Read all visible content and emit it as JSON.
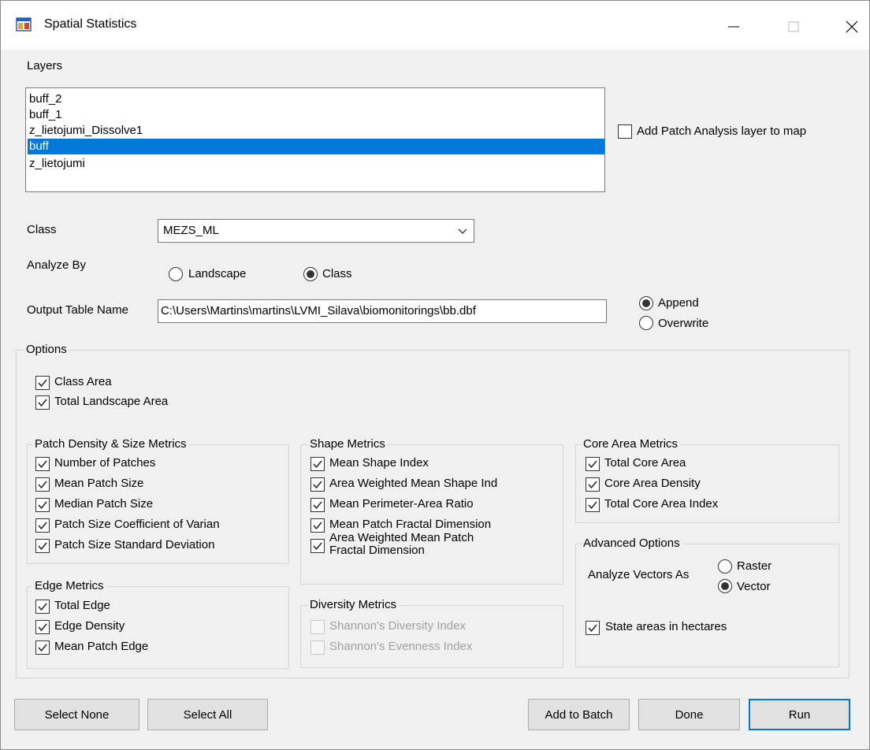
{
  "window": {
    "title": "Spatial Statistics",
    "icon": "app-window-icon",
    "controls": [
      "minimize-icon",
      "maximize-icon",
      "close-icon"
    ]
  },
  "layers": {
    "label": "Layers",
    "items": [
      "buff_2",
      "buff_1",
      "z_lietojumi_Dissolve1",
      "buff",
      "z_lietojumi"
    ],
    "selected": "buff"
  },
  "add_patch_layer": {
    "label": "Add Patch Analysis layer to map",
    "checked": false
  },
  "class": {
    "label": "Class",
    "value": "MEZS_ML"
  },
  "analyze_by": {
    "label": "Analyze By",
    "options": [
      "Landscape",
      "Class"
    ],
    "selected": "Class"
  },
  "output": {
    "label": "Output Table Name",
    "value": "C:\\Users\\Martins\\martins\\LVMI_Silava\\biomonitorings\\bb.dbf",
    "modes": [
      "Append",
      "Overwrite"
    ],
    "selected_mode": "Append"
  },
  "options": {
    "label": "Options",
    "class_area": {
      "label": "Class Area",
      "checked": true
    },
    "total_landscape_area": {
      "label": "Total Landscape Area",
      "checked": true
    }
  },
  "patch_density": {
    "title": "Patch Density & Size Metrics",
    "items": [
      {
        "label": "Number of Patches",
        "checked": true
      },
      {
        "label": "Mean Patch Size",
        "checked": true
      },
      {
        "label": "Median Patch Size",
        "checked": true
      },
      {
        "label": "Patch Size Coefficient of Varian",
        "checked": true
      },
      {
        "label": "Patch Size Standard Deviation",
        "checked": true
      }
    ]
  },
  "edge": {
    "title": "Edge Metrics",
    "items": [
      {
        "label": "Total Edge",
        "checked": true
      },
      {
        "label": "Edge Density",
        "checked": true
      },
      {
        "label": "Mean Patch Edge",
        "checked": true
      }
    ]
  },
  "shape": {
    "title": "Shape Metrics",
    "items": [
      {
        "label": "Mean Shape Index",
        "checked": true
      },
      {
        "label": "Area Weighted  Mean  Shape Ind",
        "checked": true
      },
      {
        "label": "Mean Perimeter-Area Ratio",
        "checked": true
      },
      {
        "label": "Mean Patch Fractal Dimension",
        "checked": true
      },
      {
        "label": "Area Weighted Mean Patch",
        "label2": "Fractal Dimension",
        "checked": true
      }
    ]
  },
  "diversity": {
    "title": "Diversity Metrics",
    "items": [
      {
        "label": "Shannon's Diversity Index",
        "checked": false,
        "enabled": false
      },
      {
        "label": "Shannon's Evenness Index",
        "checked": false,
        "enabled": false
      }
    ]
  },
  "core": {
    "title": "Core Area Metrics",
    "items": [
      {
        "label": "Total Core Area",
        "checked": true
      },
      {
        "label": "Core Area Density",
        "checked": true
      },
      {
        "label": "Total Core Area Index",
        "checked": true
      }
    ]
  },
  "advanced": {
    "title": "Advanced Options",
    "analyze_vectors_label": "Analyze Vectors As",
    "modes": [
      "Raster",
      "Vector"
    ],
    "selected_mode": "Vector",
    "hectares": {
      "label": "State areas in hectares",
      "checked": true
    }
  },
  "buttons": {
    "select_none": "Select None",
    "select_all": "Select All",
    "add_to_batch": "Add to Batch",
    "done": "Done",
    "run": "Run"
  },
  "colors": {
    "selection": "#0078d7",
    "dialog_bg": "#f0f0f0",
    "default_button_border": "#0078d7"
  }
}
